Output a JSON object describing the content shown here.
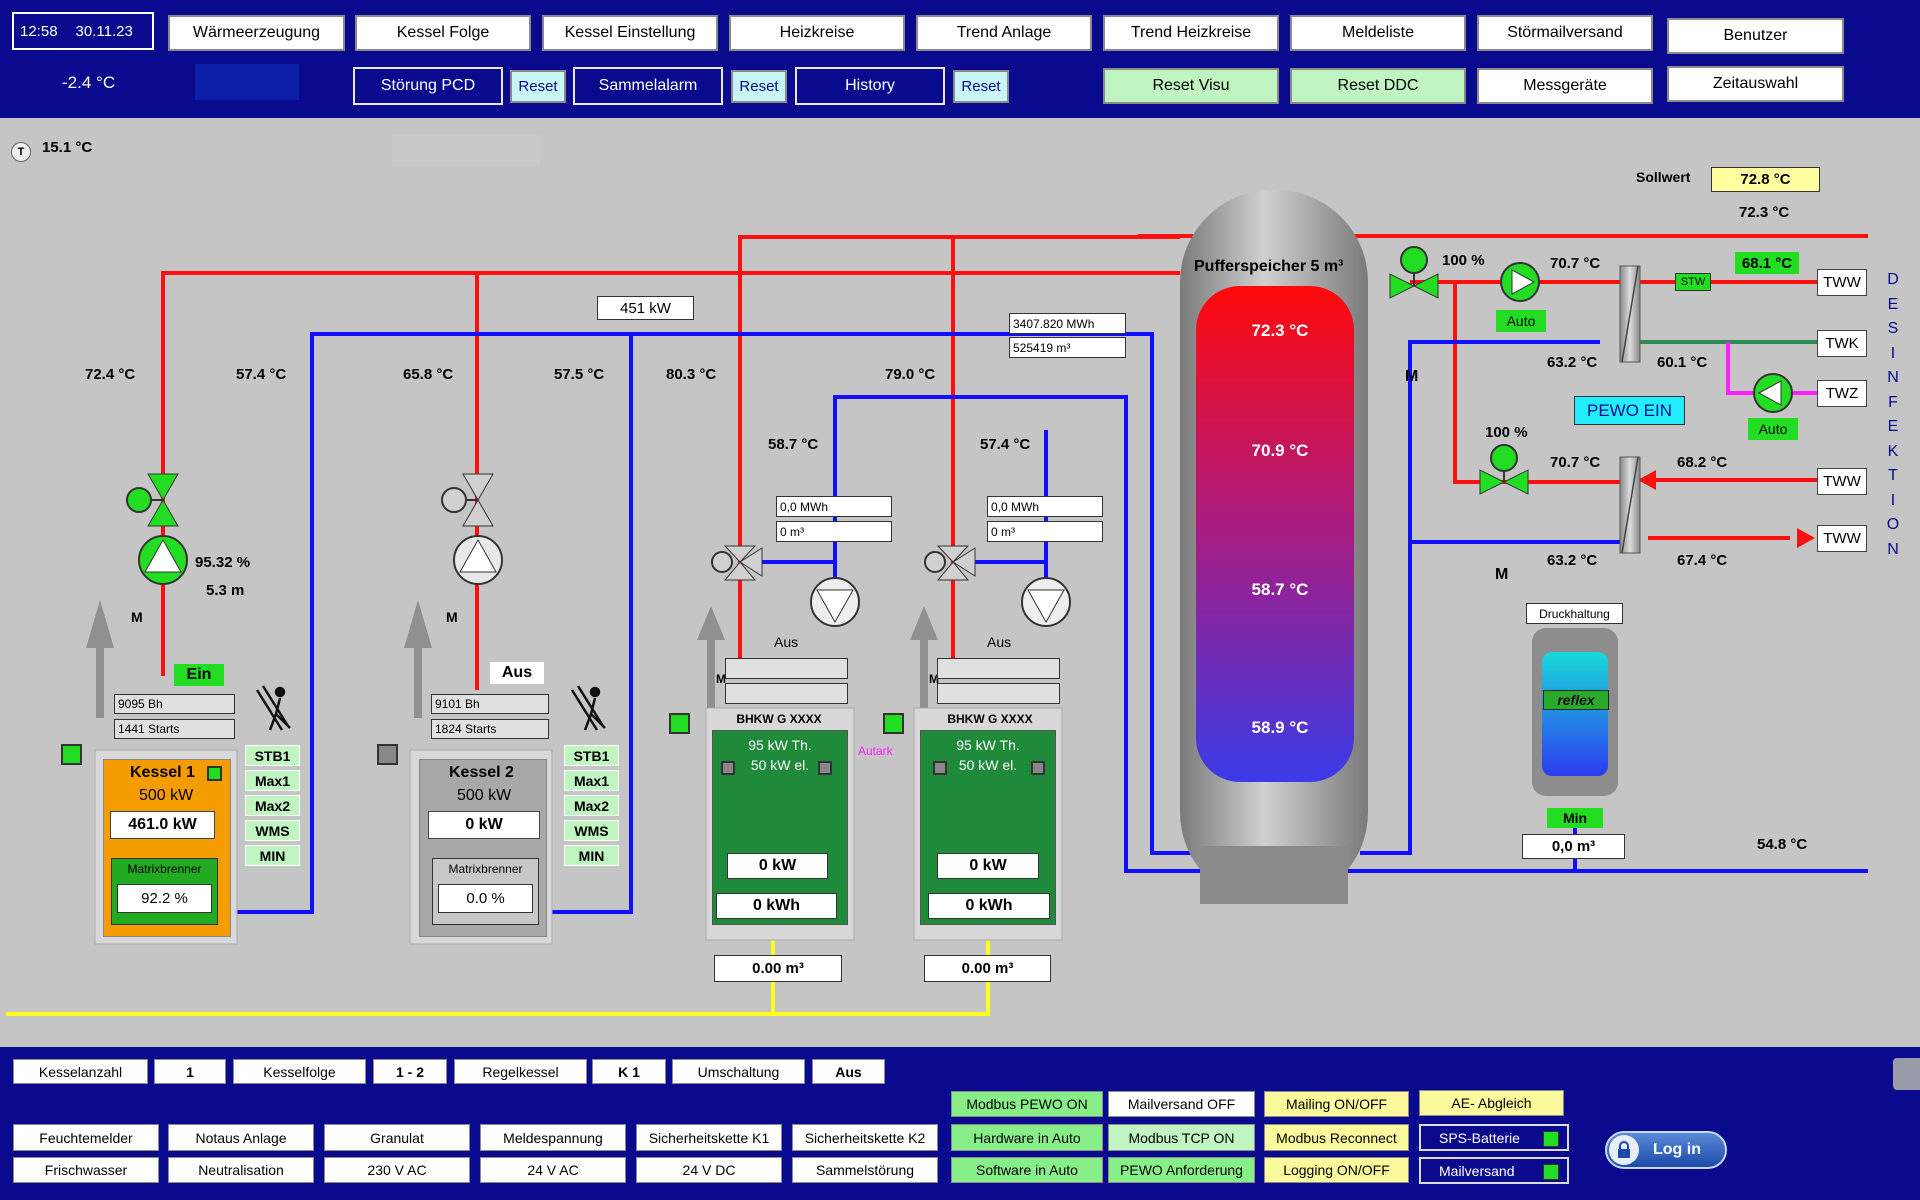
{
  "header": {
    "time": "12:58",
    "date": "30.11.23",
    "outdoor_temp": "-2.4 °C",
    "nav1": [
      "Wärmeerzeugung",
      "Kessel Folge",
      "Kessel Einstellung",
      "Heizkreise",
      "Trend Anlage",
      "Trend Heizkreise",
      "Meldeliste",
      "Störmailversand",
      "Benutzer"
    ],
    "stoerung_pcd": "Störung PCD",
    "sammelalarm": "Sammelalarm",
    "history": "History",
    "reset": "Reset",
    "reset_visu": "Reset Visu",
    "reset_ddc": "Reset DDC",
    "messgeraete": "Messgeräte",
    "zeitauswahl": "Zeitauswahl"
  },
  "plant": {
    "room_temp": "15.1 °C",
    "temp_sensor_symbol": "T",
    "sollwert_label": "Sollwert",
    "sollwert": "72.8 °C",
    "sollwert_actual": "72.3 °C",
    "supply_power": "451 kW",
    "energy_total": "3407.820 MWh",
    "volume_total": "525419 m³",
    "temps": {
      "k1_vl": "72.4 °C",
      "k1_rl": "57.4 °C",
      "k2_vl": "65.8 °C",
      "k2_rl": "57.5 °C",
      "bhkw1_vl": "80.3 °C",
      "bhkw1_rl": "58.7 °C",
      "bhkw2_vl": "79.0 °C",
      "bhkw2_rl": "57.4 °C",
      "ww1_vl": "70.7 °C",
      "ww1_rl": "63.2 °C",
      "twk": "60.1 °C",
      "tww_out": "68.1 °C",
      "ww2_vl": "70.7 °C",
      "ww2_rl": "63.2 °C",
      "ww2_in": "68.2 °C",
      "ww2_out": "67.4 °C",
      "return_main": "54.8 °C"
    },
    "pump_k1_pct": "95.32 %",
    "pump_k1_head": "5.3 m",
    "valve_pct_top": "100 %",
    "valve_pct_bottom": "100 %",
    "auto": "Auto",
    "stw": "STW",
    "pewo_ein": "PEWO EIN",
    "tww": "TWW",
    "twk": "TWK",
    "twz": "TWZ",
    "desinfektion": [
      "D",
      "E",
      "S",
      "I",
      "N",
      "F",
      "E",
      "K",
      "T",
      "I",
      "O",
      "N"
    ],
    "valve_symbol": "M",
    "buffer": {
      "title": "Pufferspeicher 5 m³",
      "t1": "72.3 °C",
      "t2": "70.9 °C",
      "t3": "58.7 °C",
      "t4": "58.9 °C"
    },
    "druckhaltung": "Druckhaltung",
    "reflex": "reflex",
    "min": "Min",
    "druck_volume": "0,0 m³",
    "kessel1": {
      "status": "Ein",
      "hours": "9095 Bh",
      "starts": "1441 Starts",
      "name": "Kessel 1",
      "rated": "500 kW",
      "power": "461.0 kW",
      "burner": "Matrixbrenner",
      "burner_pct": "92.2 %",
      "alarms": [
        "STB1",
        "Max1",
        "Max2",
        "WMS",
        "MIN"
      ]
    },
    "kessel2": {
      "status": "Aus",
      "hours": "9101 Bh",
      "starts": "1824 Starts",
      "name": "Kessel 2",
      "rated": "500 kW",
      "power": "0 kW",
      "burner": "Matrixbrenner",
      "burner_pct": "0.0 %",
      "alarms": [
        "STB1",
        "Max1",
        "Max2",
        "WMS",
        "MIN"
      ]
    },
    "bhkw1": {
      "status": "Aus",
      "energy": "0,0 MWh",
      "volume": "0 m³",
      "name": "BHKW G XXXX",
      "th": "95 kW Th.",
      "el": "50 kW el.",
      "power": "0 kW",
      "kwh": "0 kWh",
      "gas": "0.00 m³"
    },
    "bhkw2": {
      "status": "Aus",
      "energy": "0,0 MWh",
      "volume": "0 m³",
      "name": "BHKW G XXXX",
      "th": "95 kW Th.",
      "el": "50 kW el.",
      "power": "0 kW",
      "kwh": "0 kWh",
      "gas": "0.00 m³"
    },
    "autark": "Autark"
  },
  "footer": {
    "row1": [
      "Kesselanzahl",
      "1",
      "Kesselfolge",
      "1 - 2",
      "Regelkessel",
      "K 1",
      "Umschaltung",
      "Aus"
    ],
    "row2": [
      "Feuchtemelder",
      "Notaus Anlage",
      "Granulat",
      "Meldespannung",
      "Sicherheitskette K1",
      "Sicherheitskette K2"
    ],
    "row3": [
      "Frischwasser",
      "Neutralisation",
      "230 V AC",
      "24 V AC",
      "24 V DC",
      "Sammelstörung"
    ],
    "modbus_pewo": "Modbus PEWO ON",
    "mailversand_off": "Mailversand OFF",
    "mailing_onoff": "Mailing ON/OFF",
    "ae_abgleich": "AE- Abgleich",
    "hardware_auto": "Hardware in Auto",
    "modbus_tcp": "Modbus TCP ON",
    "modbus_reconnect": "Modbus Reconnect",
    "sps_batterie": "SPS-Batterie",
    "software_auto": "Software in Auto",
    "pewo_anforderung": "PEWO Anforderung",
    "logging_onoff": "Logging ON/OFF",
    "mailversand": "Mailversand",
    "login": "Log in"
  }
}
